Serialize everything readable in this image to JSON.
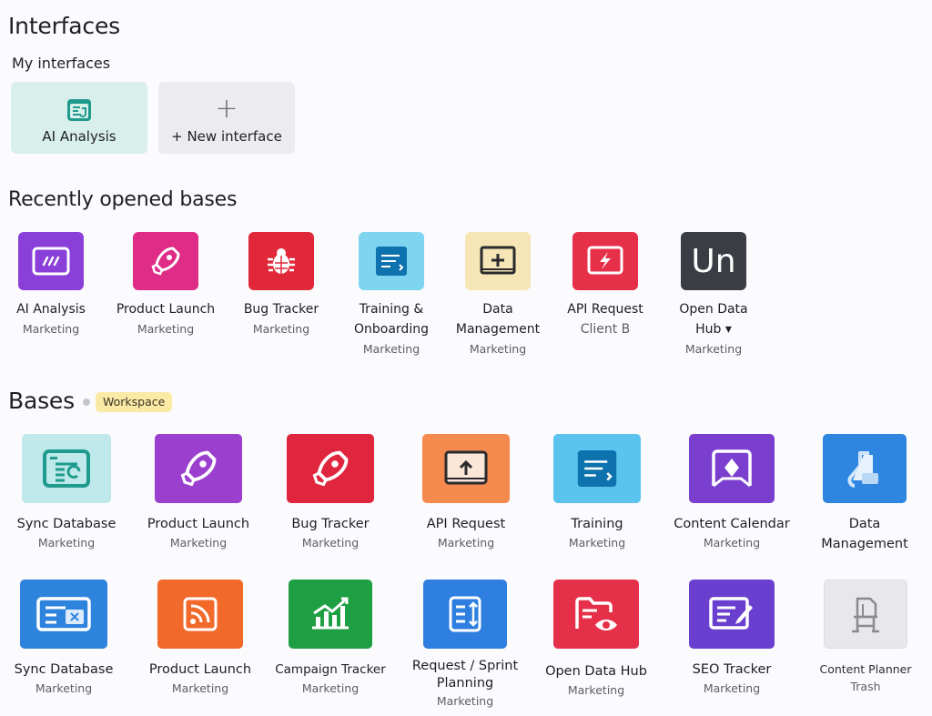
{
  "page": {
    "title": "Interfaces"
  },
  "my_interfaces": {
    "heading": "My interfaces",
    "cards": [
      {
        "label": "AI Analysis",
        "icon": "interface-dashboard-icon",
        "color": "#1f9b8e"
      },
      {
        "label": "+ New interface",
        "icon": "plus-icon"
      }
    ]
  },
  "recent": {
    "heading": "Recently opened bases",
    "items": [
      {
        "name": "AI Analysis",
        "workspace": "Marketing",
        "color": "#8b3fd9",
        "icon": "slash-window-icon"
      },
      {
        "name": "Product Launch",
        "workspace": "Marketing",
        "color": "#df2d87",
        "icon": "rocket-icon"
      },
      {
        "name": "Bug Tracker",
        "workspace": "Marketing",
        "color": "#e0283a",
        "icon": "bug-icon"
      },
      {
        "name": "Training &",
        "name2": "Onboarding",
        "workspace": "Marketing",
        "color": "#7fd4f0",
        "icon": "training-doc-icon"
      },
      {
        "name": "Data",
        "name2": "Management",
        "workspace": "Marketing",
        "color": "#f6e5b5",
        "icon": "data-window-icon"
      },
      {
        "name": "API Request",
        "workspace": "Client B",
        "color": "#e6304a",
        "icon": "lightning-screen-icon"
      },
      {
        "name": "Open Data",
        "name2": "Hub ▾",
        "workspace": "Marketing",
        "color": "#3a3d44",
        "icon": "un-monogram-icon",
        "monogram": "Un"
      }
    ]
  },
  "bases": {
    "heading": "Bases",
    "badge": "Workspace",
    "row1": [
      {
        "name": "Sync Database",
        "workspace": "Marketing",
        "color": "#bfe9ea",
        "icon": "sync-window-icon"
      },
      {
        "name": "Product Launch",
        "workspace": "Marketing",
        "color": "#9b3fce",
        "icon": "rocket-icon"
      },
      {
        "name": "Bug Tracker",
        "workspace": "Marketing",
        "color": "#e0263f",
        "icon": "rocket-icon"
      },
      {
        "name": "API Request",
        "workspace": "Marketing",
        "color": "#f48a4e",
        "icon": "upload-window-icon"
      },
      {
        "name": "Training",
        "workspace": "Marketing",
        "color": "#5ac4ef",
        "icon": "training-doc-icon"
      },
      {
        "name": "Content Calendar",
        "workspace": "Marketing",
        "color": "#7b3fd0",
        "icon": "frame-diamond-icon"
      },
      {
        "name": "Data",
        "name2": "Management",
        "workspace": "",
        "color": "#2e86e0",
        "icon": "flask-icon"
      }
    ],
    "row2": [
      {
        "name": "Sync Database",
        "workspace": "Marketing",
        "color": "#2e84dc",
        "icon": "sync-card-icon"
      },
      {
        "name": "Product Launch",
        "workspace": "Marketing",
        "color": "#f26a2a",
        "icon": "rss-icon"
      },
      {
        "name": "Campaign Tracker",
        "workspace": "Marketing",
        "color": "#1f9f44",
        "icon": "chart-growth-icon"
      },
      {
        "name": "Request / Sprint",
        "name2": "Planning",
        "workspace": "Marketing",
        "color": "#2e7fe0",
        "icon": "sprint-list-icon"
      },
      {
        "name": "Open Data Hub",
        "workspace": "Marketing",
        "color": "#e6304a",
        "icon": "folder-eye-icon"
      },
      {
        "name": "SEO Tracker",
        "workspace": "Marketing",
        "color": "#6a3fcf",
        "icon": "pencil-doc-icon"
      },
      {
        "name": "Content Planner",
        "workspace": "Trash",
        "color": "#e8e8ea",
        "icon": "chair-outline-icon"
      }
    ]
  }
}
